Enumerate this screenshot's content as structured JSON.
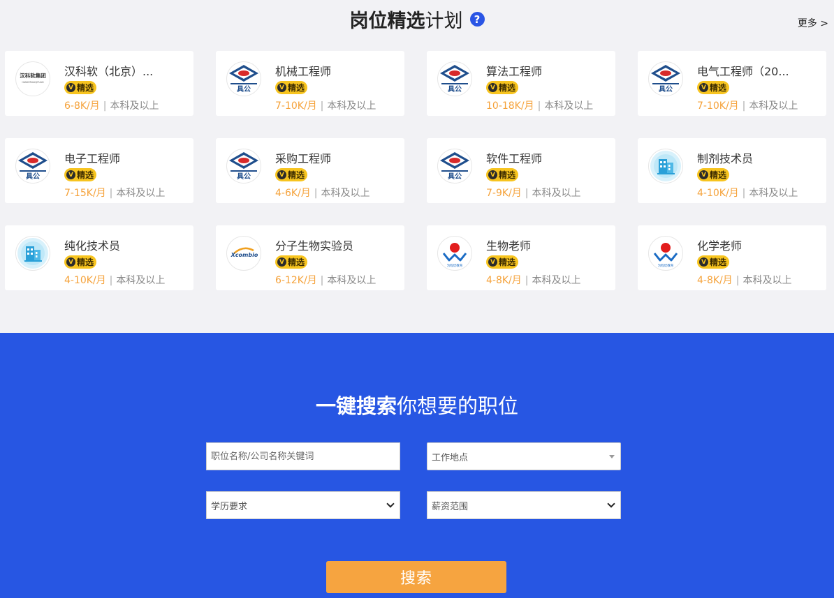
{
  "header": {
    "title_strong": "岗位精选",
    "title_light": "计划",
    "help_icon": "question-circle-icon",
    "more_label": "更多 >"
  },
  "badge_label": "精选",
  "badge_icon_char": "V",
  "jobs": [
    {
      "name": "汉科软（北京）...",
      "salary": "6-8K/月",
      "edu": "本科及以上",
      "logo": "hankersoft-logo"
    },
    {
      "name": "机械工程师",
      "salary": "7-10K/月",
      "edu": "本科及以上",
      "logo": "diamond-company-logo"
    },
    {
      "name": "算法工程师",
      "salary": "10-18K/月",
      "edu": "本科及以上",
      "logo": "diamond-company-logo"
    },
    {
      "name": "电气工程师（20...",
      "salary": "7-10K/月",
      "edu": "本科及以上",
      "logo": "diamond-company-logo"
    },
    {
      "name": "电子工程师",
      "salary": "7-15K/月",
      "edu": "本科及以上",
      "logo": "diamond-company-logo"
    },
    {
      "name": "采购工程师",
      "salary": "4-6K/月",
      "edu": "本科及以上",
      "logo": "diamond-company-logo"
    },
    {
      "name": "软件工程师",
      "salary": "7-9K/月",
      "edu": "本科及以上",
      "logo": "diamond-company-logo"
    },
    {
      "name": "制剂技术员",
      "salary": "4-10K/月",
      "edu": "本科及以上",
      "logo": "building-logo"
    },
    {
      "name": "纯化技术员",
      "salary": "4-10K/月",
      "edu": "本科及以上",
      "logo": "building-logo"
    },
    {
      "name": "分子生物实验员",
      "salary": "6-12K/月",
      "edu": "本科及以上",
      "logo": "xcombio-logo"
    },
    {
      "name": "生物老师",
      "salary": "4-8K/月",
      "edu": "本科及以上",
      "logo": "sun-wave-logo"
    },
    {
      "name": "化学老师",
      "salary": "4-8K/月",
      "edu": "本科及以上",
      "logo": "sun-wave-logo"
    }
  ],
  "search": {
    "title_strong": "一键搜索",
    "title_light": "你想要的职位",
    "keyword_placeholder": "职位名称/公司名称关键词",
    "location_label": "工作地点",
    "education_label": "学历要求",
    "salary_label": "薪资范围",
    "button_label": "搜索"
  },
  "colors": {
    "accent_blue": "#2756e3",
    "salary_orange": "#f5a23a",
    "badge_yellow": "#f7c41f",
    "button_orange": "#f6a440"
  }
}
